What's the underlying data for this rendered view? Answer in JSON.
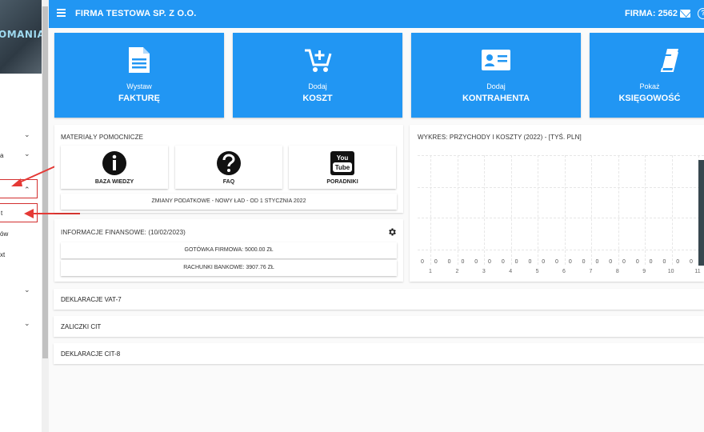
{
  "sidebar": {
    "logo_text": "OMANIA",
    "items": [
      {
        "label": "",
        "chevron": "⌄"
      },
      {
        "label": "a",
        "chevron": "⌄"
      },
      {
        "label": "",
        "chevron": "⌃"
      },
      {
        "label": "t",
        "chevron": ""
      },
      {
        "label": "ów",
        "chevron": ""
      },
      {
        "label": "xt",
        "chevron": ""
      },
      {
        "label": "",
        "chevron": "⌄"
      },
      {
        "label": "",
        "chevron": "⌄"
      }
    ]
  },
  "topbar": {
    "company": "FIRMA TESTOWA SP. Z O.O.",
    "firma_id": "FIRMA: 2562",
    "help": "?"
  },
  "tiles": [
    {
      "small": "Wystaw",
      "big": "FAKTURĘ",
      "icon": "document-icon"
    },
    {
      "small": "Dodaj",
      "big": "KOSZT",
      "icon": "cart-add-icon"
    },
    {
      "small": "Dodaj",
      "big": "KONTRAHENTA",
      "icon": "contact-card-icon"
    },
    {
      "small": "Pokaż",
      "big": "KSIĘGOWOŚĆ",
      "icon": "book-icon"
    }
  ],
  "materials": {
    "title": "MATERIAŁY POMOCNICZE",
    "buttons": [
      {
        "label": "BAZA WIEDZY",
        "icon": "info-icon"
      },
      {
        "label": "FAQ",
        "icon": "question-icon"
      },
      {
        "label": "PORADNIKI",
        "icon": "youtube-icon"
      }
    ],
    "news": "ZMIANY PODATKOWE - NOWY ŁAD - OD 1 STYCZNIA 2022"
  },
  "finance": {
    "title": "INFORMACJE FINANSOWE: (10/02/2023)",
    "cash": "GOTÓWKA FIRMOWA: 5000.00 ZŁ",
    "bank": "RACHUNKI BANKOWE: 3907.76 ZŁ"
  },
  "chart_data": {
    "type": "bar",
    "title": "WYKRES: PRZYCHODY I KOSZTY (2022) - [TYŚ. PLN]",
    "categories": [
      "1",
      "2",
      "3",
      "4",
      "5",
      "6",
      "7",
      "8",
      "9",
      "10",
      "11"
    ],
    "value_labels": [
      "0",
      "0",
      "0",
      "0",
      "0",
      "0",
      "0",
      "0",
      "0",
      "0",
      "0",
      "0",
      "0",
      "0",
      "0",
      "0",
      "0",
      "0",
      "0",
      "0",
      "0"
    ],
    "bar_color": "#37474f"
  },
  "accordions": [
    {
      "label": "DEKLARACJE VAT-7"
    },
    {
      "label": "ZALICZKI CIT"
    },
    {
      "label": "DEKLARACJE CIT-8"
    }
  ],
  "colors": {
    "primary": "#2196f3",
    "highlight": "#d32f2f"
  }
}
